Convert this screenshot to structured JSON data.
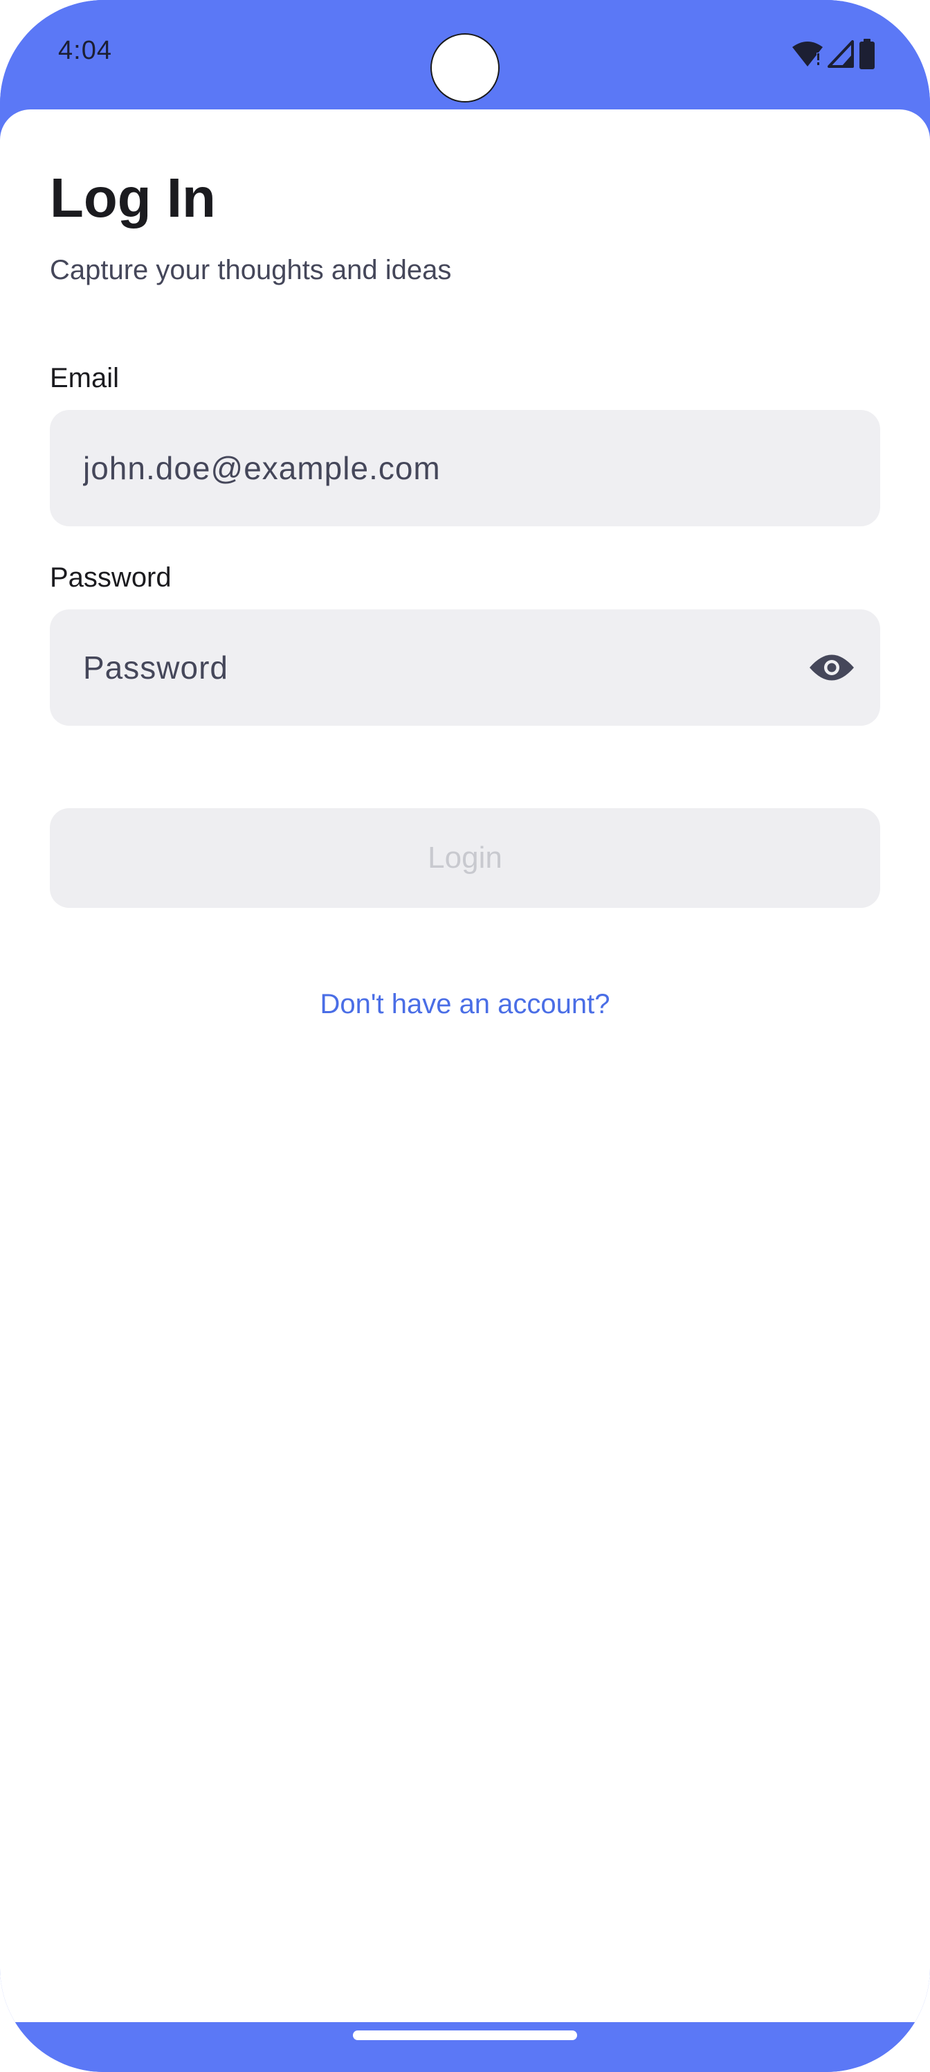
{
  "status_bar": {
    "time": "4:04",
    "icons": [
      "wifi-icon",
      "signal-icon",
      "battery-icon"
    ]
  },
  "header": {
    "title": "Log In",
    "subtitle": "Capture your thoughts and ideas"
  },
  "form": {
    "email_label": "Email",
    "email_placeholder": "john.doe@example.com",
    "password_label": "Password",
    "password_placeholder": "Password",
    "password_toggle_icon": "eye-icon",
    "login_label": "Login",
    "signup_link": "Don't have an account?"
  },
  "colors": {
    "accent": "#5b78f6",
    "link": "#4a6ee6",
    "field_background": "#efeff2",
    "disabled_text": "#c8c9cf"
  }
}
